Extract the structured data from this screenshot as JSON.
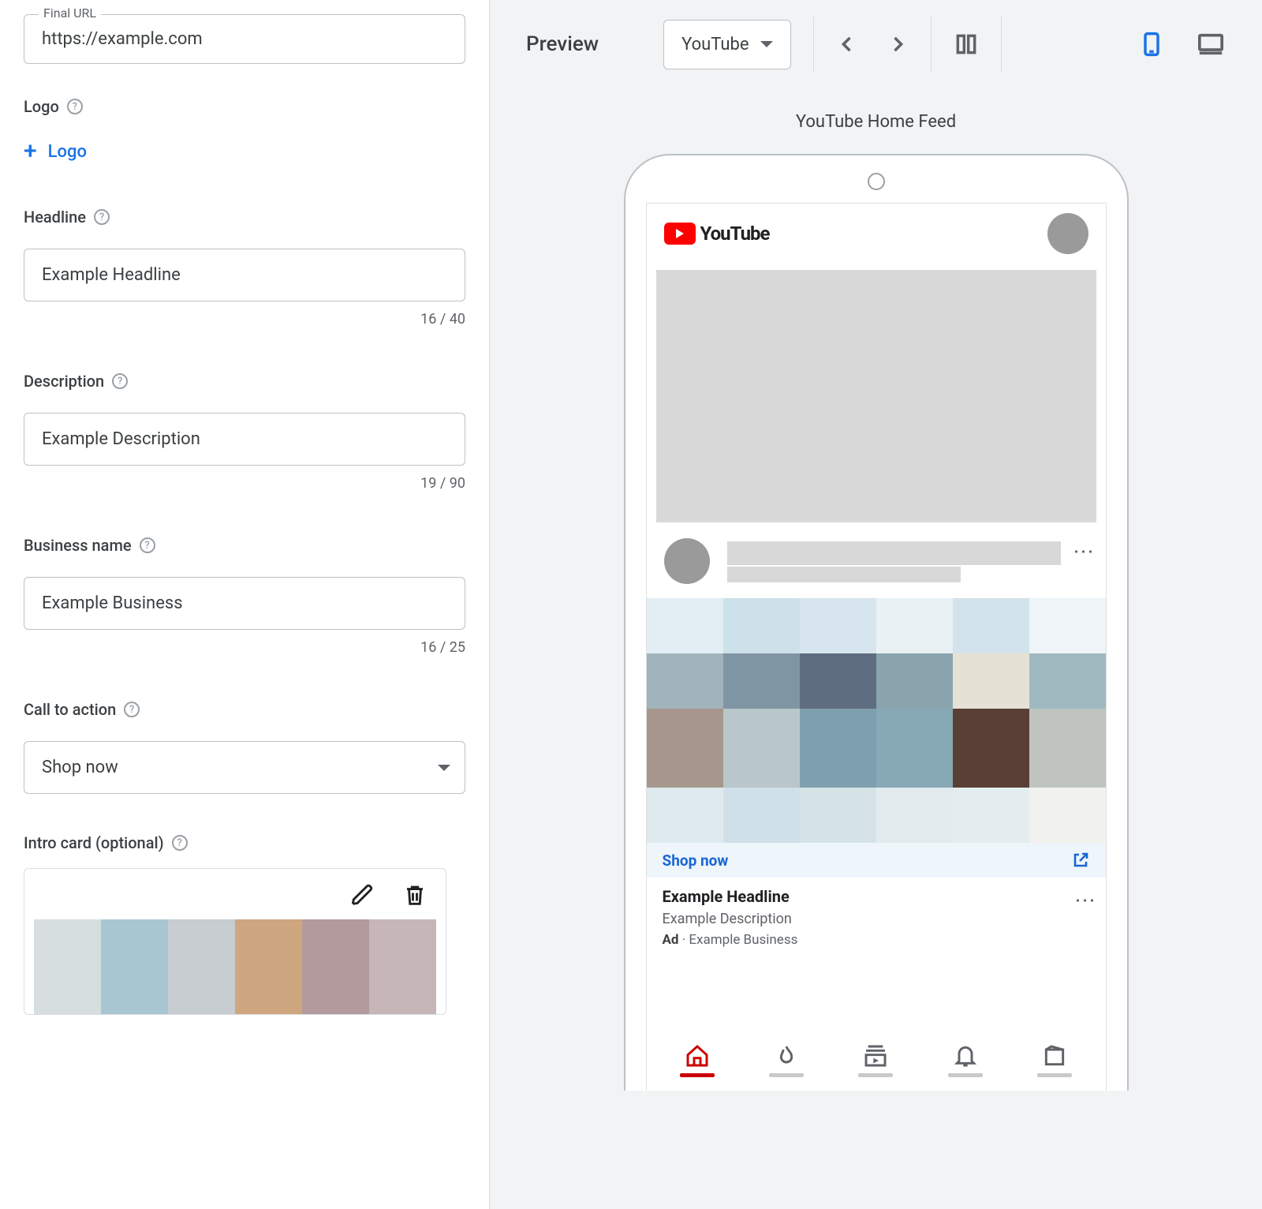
{
  "form": {
    "final_url_label": "Final URL",
    "final_url_value": "https://example.com",
    "logo_label": "Logo",
    "add_logo_label": "Logo",
    "headline_label": "Headline",
    "headline_value": "Example Headline",
    "headline_counter": "16 / 40",
    "description_label": "Description",
    "description_value": "Example Description",
    "description_counter": "19 / 90",
    "business_label": "Business name",
    "business_value": "Example Business",
    "business_counter": "16 / 25",
    "cta_label": "Call to action",
    "cta_value": "Shop now",
    "intro_label": "Intro card (optional)"
  },
  "preview": {
    "title": "Preview",
    "placement": "YouTube",
    "context": "YouTube Home Feed",
    "youtube_brand": "YouTube"
  },
  "ad": {
    "cta": "Shop now",
    "headline": "Example Headline",
    "description": "Example Description",
    "tag": "Ad",
    "business": "Example Business"
  },
  "intro_colors": [
    "#d6dedf",
    "#a8c6d2",
    "#c7cdd1",
    "#cea680",
    "#b29a9d",
    "#c6b6b8"
  ],
  "ad_pixel_rows": [
    [
      "#e2eef4",
      "#cde1ea",
      "#d7e6ee",
      "#e9f1f5",
      "#d2e3eb",
      "#eef4f7"
    ],
    [
      "#a1b3bb",
      "#7f95a3",
      "#5f6d80",
      "#8aa4ad",
      "#e6e1d5",
      "#a0b9c1"
    ],
    [
      "#a6968b",
      "#b9c7cb",
      "#7ea0ae",
      "#87a8b5",
      "#5a3f36",
      "#bfc4c1"
    ],
    [
      "#dfeaef",
      "#d0e0e9",
      "#d5e3e7",
      "#e1ebee",
      "#e3edef",
      "#f1f1ee"
    ]
  ],
  "colors": {
    "blue": "#1a73e8",
    "red": "#cc0000"
  }
}
